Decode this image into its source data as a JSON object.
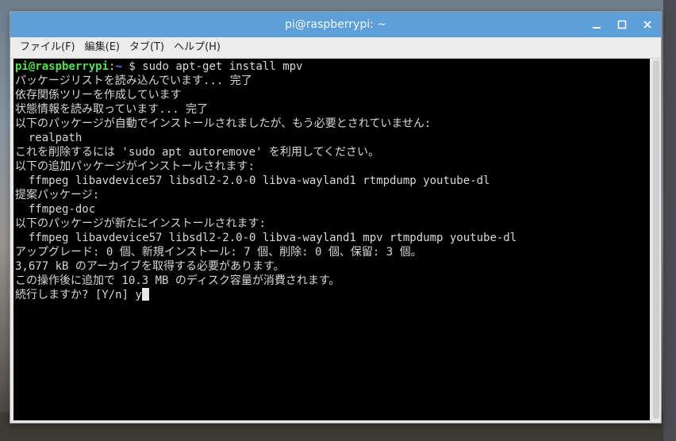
{
  "window": {
    "title": "pi@raspberrypi: ~",
    "buttons": {
      "minimize_icon": "minimize-icon",
      "maximize_icon": "maximize-icon",
      "close_icon": "close-icon"
    }
  },
  "menubar": {
    "items": [
      "ファイル(F)",
      "編集(E)",
      "タブ(T)",
      "ヘルプ(H)"
    ]
  },
  "terminal": {
    "prompt_user": "pi@raspberrypi",
    "prompt_sep": ":",
    "prompt_path": "~",
    "prompt_symbol": " $ ",
    "command": "sudo apt-get install mpv",
    "lines": [
      "パッケージリストを読み込んでいます... 完了",
      "依存関係ツリーを作成しています",
      "状態情報を読み取っています... 完了",
      "以下のパッケージが自動でインストールされましたが、もう必要とされていません:",
      "  realpath",
      "これを削除するには 'sudo apt autoremove' を利用してください。",
      "以下の追加パッケージがインストールされます:",
      "  ffmpeg libavdevice57 libsdl2-2.0-0 libva-wayland1 rtmpdump youtube-dl",
      "提案パッケージ:",
      "  ffmpeg-doc",
      "以下のパッケージが新たにインストールされます:",
      "  ffmpeg libavdevice57 libsdl2-2.0-0 libva-wayland1 mpv rtmpdump youtube-dl",
      "アップグレード: 0 個、新規インストール: 7 個、削除: 0 個、保留: 3 個。",
      "3,677 kB のアーカイブを取得する必要があります。",
      "この操作後に追加で 10.3 MB のディスク容量が消費されます。"
    ],
    "last_line_prompt": "続行しますか? [Y/n] ",
    "last_line_input": "y"
  }
}
